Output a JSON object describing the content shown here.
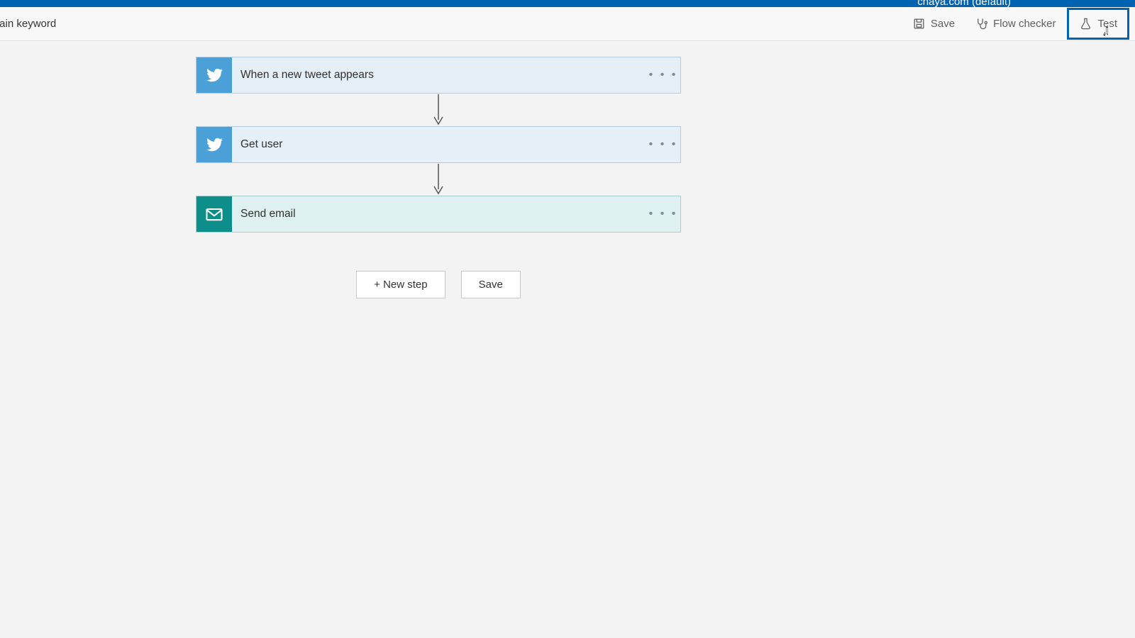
{
  "tenant": "chaya.com (default)",
  "breadcrumb": "rtain keyword",
  "toolbar": {
    "save": "Save",
    "flow_checker": "Flow checker",
    "test": "Test"
  },
  "tooltip": "Test",
  "steps": [
    {
      "label": "When a new tweet appears",
      "icon": "twitter",
      "bg": "twitter-icon"
    },
    {
      "label": "Get user",
      "icon": "twitter",
      "bg": "twitter-icon"
    },
    {
      "label": "Send email",
      "icon": "email",
      "bg": "email-icon",
      "card": "step-email"
    }
  ],
  "actions": {
    "new_step": "+ New step",
    "save": "Save"
  }
}
